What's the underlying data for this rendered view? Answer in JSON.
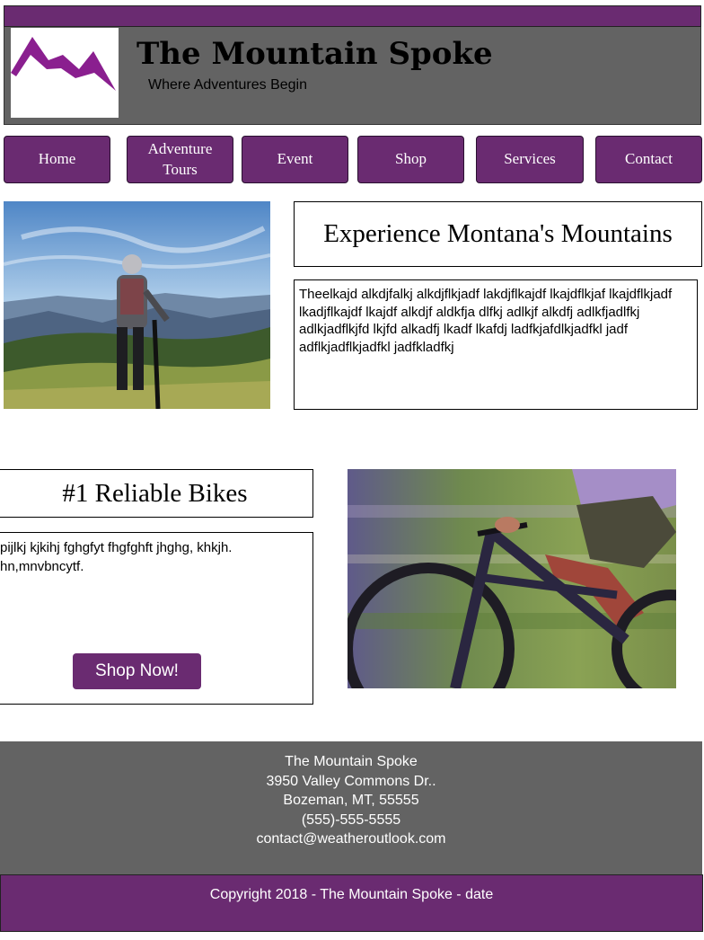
{
  "colors": {
    "brand_purple": "#6a2b71",
    "header_gray": "#636363"
  },
  "header": {
    "title": "The Mountain Spoke",
    "tagline": "Where Adventures Begin",
    "logo_icon": "mountain-logo-icon"
  },
  "nav": {
    "home": "Home",
    "adventure_tours": "Adventure Tours",
    "event": "Event",
    "shop": "Shop",
    "services": "Services",
    "contact": "Contact"
  },
  "section1": {
    "image": "mountain-biker-photo",
    "heading": "Experience Montana's Mountains",
    "body": "Theelkajd alkdjfalkj alkdjflkjadf lakdjflkajdf lkajdflkjaf lkajdflkjadf lkadjflkajdf lkajdf alkdjf aldkfja dlfkj adlkjf alkdfj adlkfjadlfkj adlkjadflkjfd lkjfd alkadfj lkadf lkafdj ladfkjafdlkjadfkl jadf adflkjadflkjadfkl jadfkladfkj"
  },
  "section2": {
    "heading": "#1 Reliable Bikes",
    "body_line1": "pijlkj kjkihj fghgfyt fhgfghft jhghg, khkjh.",
    "body_line2": "hn,mnvbncytf.",
    "button": "Shop Now!",
    "image": "motion-bike-photo"
  },
  "footer": {
    "name": "The Mountain Spoke",
    "street": "3950 Valley Commons Dr..",
    "city": "Bozeman, MT, 55555",
    "phone": "(555)-555-5555",
    "email": "contact@weatheroutlook.com",
    "copyright": "Copyright 2018 - The Mountain Spoke - date"
  }
}
